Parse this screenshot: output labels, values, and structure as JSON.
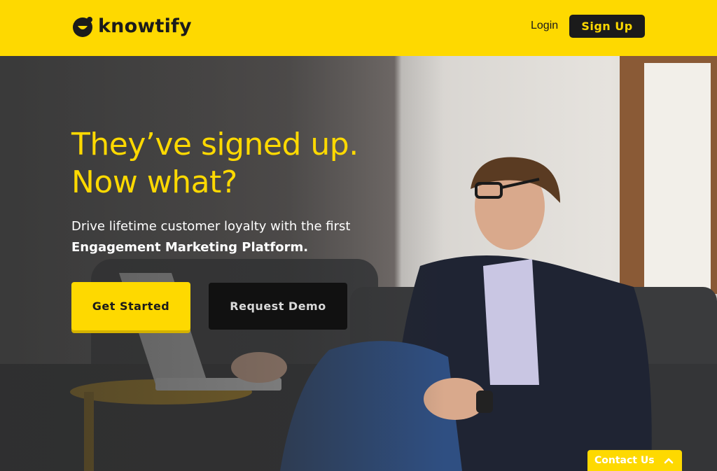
{
  "brand": {
    "name": "knowtify"
  },
  "header": {
    "login_label": "Login",
    "signup_label": "Sign Up"
  },
  "hero": {
    "headline_line1": "They’ve signed up.",
    "headline_line2": "Now what?",
    "subtitle_line1": "Drive lifetime customer loyalty with the first",
    "subtitle_line2": "Engagement Marketing Platform.",
    "primary_cta": "Get Started",
    "secondary_cta": "Request Demo"
  },
  "contact": {
    "label": "Contact Us",
    "icon": "chevron-up-icon"
  },
  "colors": {
    "brand_yellow": "#fed900",
    "dark": "#1b1b1b"
  }
}
